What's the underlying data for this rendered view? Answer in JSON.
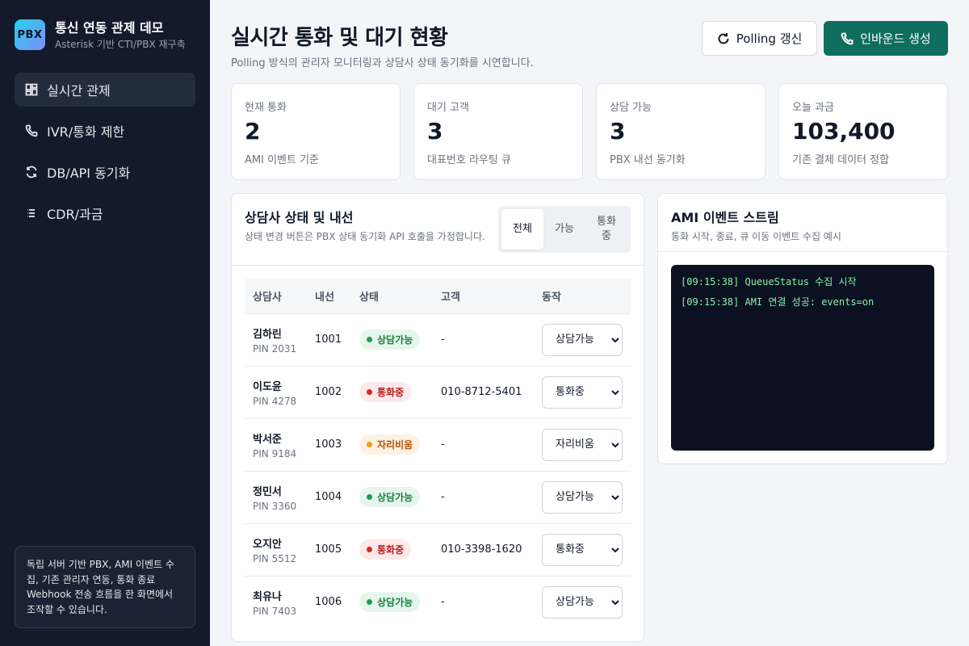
{
  "brand": {
    "logo": "PBX",
    "title": "통신 연동 관제 데모",
    "subtitle": "Asterisk 기반 CTI/PBX 재구축"
  },
  "nav": [
    {
      "label": "실시간 관제",
      "icon": "dashboard-icon",
      "active": true
    },
    {
      "label": "IVR/통화 제한",
      "icon": "phone-icon",
      "active": false
    },
    {
      "label": "DB/API 동기화",
      "icon": "sync-icon",
      "active": false
    },
    {
      "label": "CDR/과금",
      "icon": "list-icon",
      "active": false
    }
  ],
  "sidebar_note": "독립 서버 기반 PBX, AMI 이벤트 수집, 기존 관리자 연동, 통화 종료 Webhook 전송 흐름을 한 화면에서 조작할 수 있습니다.",
  "header": {
    "title": "실시간 통화 및 대기 현황",
    "subtitle": "Polling 방식의 관리자 모니터링과 상담사 상태 동기화를 시연합니다.",
    "refresh_label": "Polling 갱신",
    "inbound_label": "인바운드 생성"
  },
  "stats": [
    {
      "label": "현재 통화",
      "value": "2",
      "desc": "AMI 이벤트 기준"
    },
    {
      "label": "대기 고객",
      "value": "3",
      "desc": "대표번호 라우팅 큐"
    },
    {
      "label": "상담 가능",
      "value": "3",
      "desc": "PBX 내선 동기화"
    },
    {
      "label": "오늘 과금",
      "value": "103,400",
      "desc": "기존 결제 데이터 정합"
    }
  ],
  "agents_panel": {
    "title": "상담사 상태 및 내선",
    "subtitle": "상태 변경 버튼은 PBX 상태 동기화 API 호출을 가정합니다.",
    "filters": [
      "전체",
      "가능",
      "통화중"
    ],
    "active_filter": 0,
    "columns": [
      "상담사",
      "내선",
      "상태",
      "고객",
      "동작"
    ],
    "status_options": [
      "상담가능",
      "통화중",
      "자리비움"
    ],
    "rows": [
      {
        "name": "김하린",
        "pin": "PIN 2031",
        "ext": "1001",
        "status": "상담가능",
        "customer": "-"
      },
      {
        "name": "이도윤",
        "pin": "PIN 4278",
        "ext": "1002",
        "status": "통화중",
        "customer": "010-8712-5401"
      },
      {
        "name": "박서준",
        "pin": "PIN 9184",
        "ext": "1003",
        "status": "자리비움",
        "customer": "-"
      },
      {
        "name": "정민서",
        "pin": "PIN 3360",
        "ext": "1004",
        "status": "상담가능",
        "customer": "-"
      },
      {
        "name": "오지안",
        "pin": "PIN 5512",
        "ext": "1005",
        "status": "통화중",
        "customer": "010-3398-1620"
      },
      {
        "name": "최유나",
        "pin": "PIN 7403",
        "ext": "1006",
        "status": "상담가능",
        "customer": "-"
      }
    ]
  },
  "events_panel": {
    "title": "AMI 이벤트 스트림",
    "subtitle": "통화 시작, 종료, 큐 이동 이벤트 수집 예시",
    "lines": [
      "[09:15:38] QueueStatus 수집 시작",
      "[09:15:38] AMI 연결 성공: events=on"
    ]
  },
  "colors": {
    "sidebar_bg": "#121a2b",
    "primary": "#0f6d5e",
    "status_available": "#16a34a",
    "status_busy": "#dc2626",
    "status_away": "#f59e0b",
    "console_bg": "#0b1120",
    "console_text": "#86efac"
  }
}
